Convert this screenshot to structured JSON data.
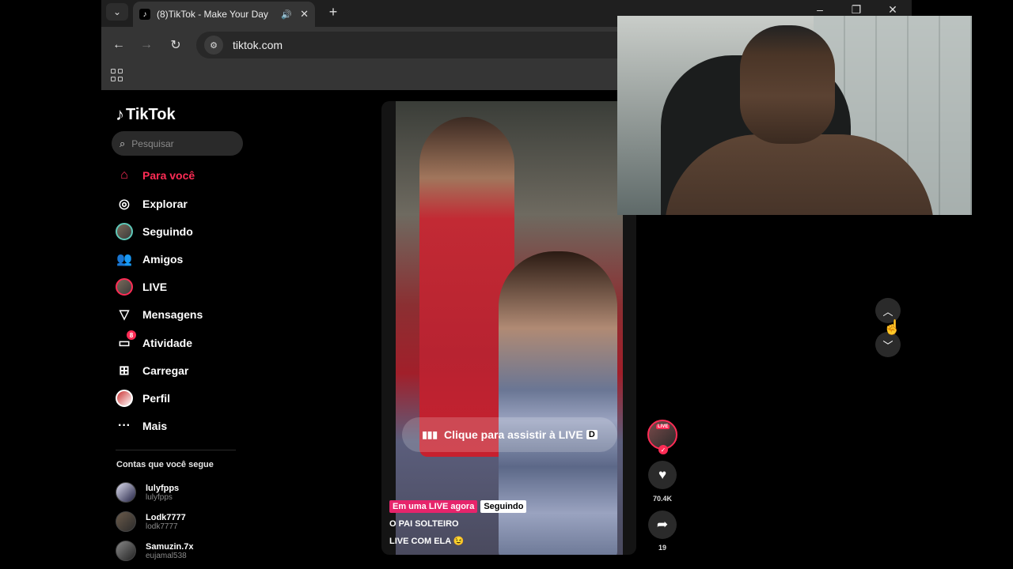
{
  "browser": {
    "tab_title": "(8)TikTok - Make Your Day",
    "url": "tiktok.com",
    "new_tab": "+"
  },
  "sidebar": {
    "logo": "TikTok",
    "search_placeholder": "Pesquisar",
    "nav": [
      {
        "label": "Para você",
        "icon": "home-icon",
        "active": true
      },
      {
        "label": "Explorar",
        "icon": "compass-icon"
      },
      {
        "label": "Seguindo",
        "icon": "following-avatar-icon"
      },
      {
        "label": "Amigos",
        "icon": "friends-icon"
      },
      {
        "label": "LIVE",
        "icon": "live-avatar-icon"
      },
      {
        "label": "Mensagens",
        "icon": "send-icon"
      },
      {
        "label": "Atividade",
        "icon": "activity-icon",
        "badge": "8"
      },
      {
        "label": "Carregar",
        "icon": "upload-icon"
      },
      {
        "label": "Perfil",
        "icon": "profile-avatar-icon"
      },
      {
        "label": "Mais",
        "icon": "more-icon"
      }
    ],
    "following_title": "Contas que você segue",
    "following": [
      {
        "name": "lulyfpps",
        "handle": "lulyfpps"
      },
      {
        "name": "Lodk7777",
        "handle": "lodk7777"
      },
      {
        "name": "Samuzin.7x",
        "handle": "eujamal538"
      }
    ]
  },
  "video": {
    "live_cta": "Clique para assistir à LIVE",
    "live_cta_key": "D",
    "tag_live": "Em uma LIVE agora",
    "tag_following": "Seguindo",
    "caption_line1": "O PAI SOLTEIRO",
    "caption_line2": "LIVE COM ELA 😉",
    "live_badge": "LIVE"
  },
  "actions": {
    "likes": "70.4K",
    "shares": "19"
  },
  "colors": {
    "accent": "#fe2c55",
    "live_tag": "#e6246b",
    "background": "#000000"
  }
}
